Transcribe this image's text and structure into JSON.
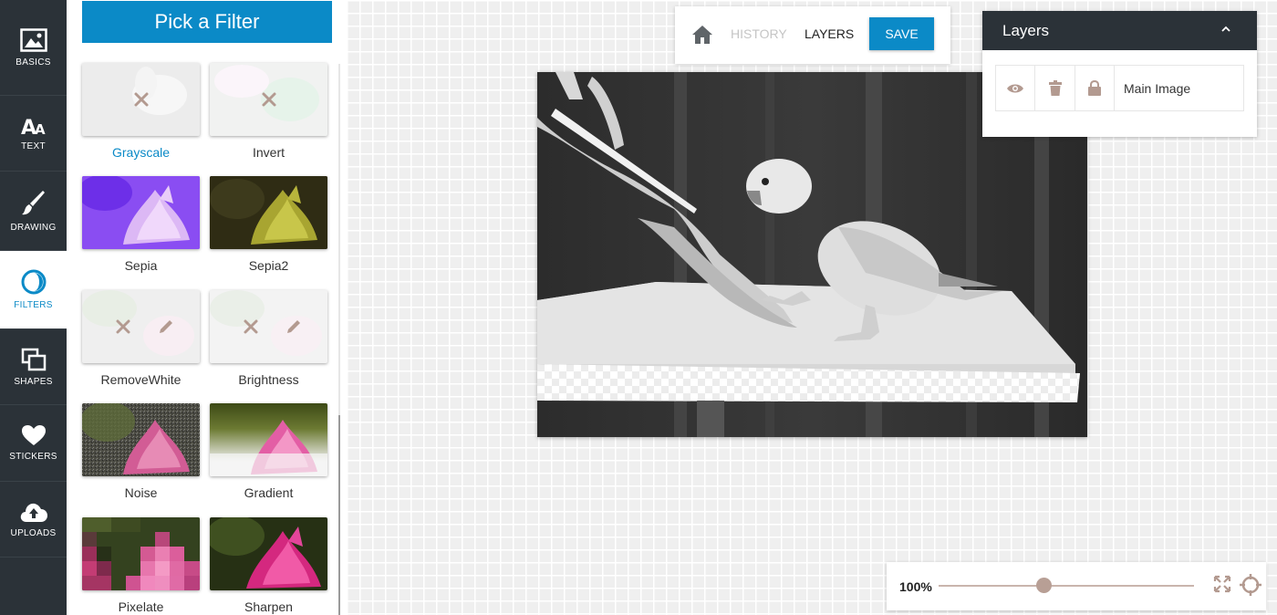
{
  "nav": {
    "items": [
      {
        "label": "BASICS",
        "icon": "image-icon"
      },
      {
        "label": "TEXT",
        "icon": "text-icon"
      },
      {
        "label": "DRAWING",
        "icon": "brush-icon"
      },
      {
        "label": "FILTERS",
        "icon": "filter-icon",
        "active": true
      },
      {
        "label": "SHAPES",
        "icon": "shapes-icon"
      },
      {
        "label": "STICKERS",
        "icon": "heart-icon"
      },
      {
        "label": "UPLOADS",
        "icon": "cloud-upload-icon"
      }
    ]
  },
  "panel": {
    "title": "Pick a Filter",
    "filters": [
      {
        "label": "Grayscale",
        "selected": true
      },
      {
        "label": "Invert"
      },
      {
        "label": "Sepia"
      },
      {
        "label": "Sepia2"
      },
      {
        "label": "RemoveWhite"
      },
      {
        "label": "Brightness"
      },
      {
        "label": "Noise"
      },
      {
        "label": "Gradient"
      },
      {
        "label": "Pixelate"
      },
      {
        "label": "Sharpen"
      }
    ]
  },
  "toolbar": {
    "history_label": "HISTORY",
    "layers_label": "LAYERS",
    "save_label": "SAVE"
  },
  "layers_panel": {
    "title": "Layers",
    "layer_name": "Main Image"
  },
  "zoom": {
    "value": "100%"
  },
  "colors": {
    "accent": "#0b8ac7",
    "nav_bg": "#2b3238",
    "slider": "#b89f95"
  }
}
